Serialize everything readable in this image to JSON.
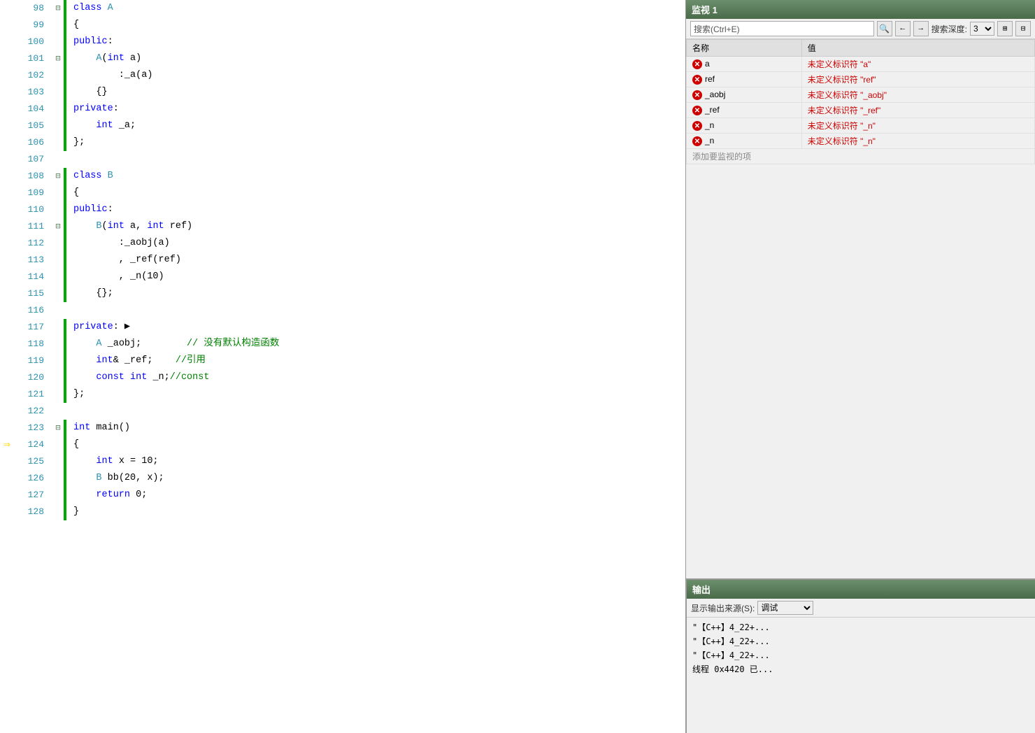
{
  "editor": {
    "lines": [
      {
        "num": 98,
        "hasGreenBar": true,
        "hasFold": true,
        "foldChar": "⊟",
        "content": [
          {
            "type": "kw",
            "text": "class "
          },
          {
            "type": "cls",
            "text": "A"
          }
        ],
        "arrow": false
      },
      {
        "num": 99,
        "hasGreenBar": true,
        "hasFold": false,
        "foldChar": "",
        "content": [
          {
            "type": "plain",
            "text": "{"
          }
        ],
        "arrow": false
      },
      {
        "num": 100,
        "hasGreenBar": true,
        "hasFold": false,
        "foldChar": "",
        "content": [
          {
            "type": "kw",
            "text": "public"
          },
          {
            "type": "plain",
            "text": ":"
          }
        ],
        "arrow": false
      },
      {
        "num": 101,
        "hasGreenBar": true,
        "hasFold": true,
        "foldChar": "⊟",
        "content": [
          {
            "type": "plain",
            "text": "    "
          },
          {
            "type": "cls",
            "text": "A"
          },
          {
            "type": "plain",
            "text": "("
          },
          {
            "type": "kw",
            "text": "int"
          },
          {
            "type": "plain",
            "text": " a)"
          }
        ],
        "arrow": false
      },
      {
        "num": 102,
        "hasGreenBar": true,
        "hasFold": false,
        "foldChar": "",
        "content": [
          {
            "type": "plain",
            "text": "        :_a(a)"
          }
        ],
        "arrow": false
      },
      {
        "num": 103,
        "hasGreenBar": true,
        "hasFold": false,
        "foldChar": "",
        "content": [
          {
            "type": "plain",
            "text": "    {}"
          }
        ],
        "arrow": false
      },
      {
        "num": 104,
        "hasGreenBar": true,
        "hasFold": false,
        "foldChar": "",
        "content": [
          {
            "type": "kw",
            "text": "private"
          },
          {
            "type": "plain",
            "text": ":"
          }
        ],
        "arrow": false
      },
      {
        "num": 105,
        "hasGreenBar": true,
        "hasFold": false,
        "foldChar": "",
        "content": [
          {
            "type": "plain",
            "text": "    "
          },
          {
            "type": "kw",
            "text": "int"
          },
          {
            "type": "plain",
            "text": " _a;"
          }
        ],
        "arrow": false
      },
      {
        "num": 106,
        "hasGreenBar": true,
        "hasFold": false,
        "foldChar": "",
        "content": [
          {
            "type": "plain",
            "text": "};"
          }
        ],
        "arrow": false
      },
      {
        "num": 107,
        "hasGreenBar": false,
        "hasFold": false,
        "foldChar": "",
        "content": [],
        "arrow": false
      },
      {
        "num": 108,
        "hasGreenBar": true,
        "hasFold": true,
        "foldChar": "⊟",
        "content": [
          {
            "type": "kw",
            "text": "class "
          },
          {
            "type": "cls",
            "text": "B"
          }
        ],
        "arrow": false
      },
      {
        "num": 109,
        "hasGreenBar": true,
        "hasFold": false,
        "foldChar": "",
        "content": [
          {
            "type": "plain",
            "text": "{"
          }
        ],
        "arrow": false
      },
      {
        "num": 110,
        "hasGreenBar": true,
        "hasFold": false,
        "foldChar": "",
        "content": [
          {
            "type": "kw",
            "text": "public"
          },
          {
            "type": "plain",
            "text": ":"
          }
        ],
        "arrow": false
      },
      {
        "num": 111,
        "hasGreenBar": true,
        "hasFold": true,
        "foldChar": "⊟",
        "content": [
          {
            "type": "plain",
            "text": "    "
          },
          {
            "type": "cls",
            "text": "B"
          },
          {
            "type": "plain",
            "text": "("
          },
          {
            "type": "kw",
            "text": "int"
          },
          {
            "type": "plain",
            "text": " a, "
          },
          {
            "type": "kw",
            "text": "int"
          },
          {
            "type": "plain",
            "text": " ref)"
          }
        ],
        "arrow": false
      },
      {
        "num": 112,
        "hasGreenBar": true,
        "hasFold": false,
        "foldChar": "",
        "content": [
          {
            "type": "plain",
            "text": "        :_aobj(a)"
          }
        ],
        "arrow": false
      },
      {
        "num": 113,
        "hasGreenBar": true,
        "hasFold": false,
        "foldChar": "",
        "content": [
          {
            "type": "plain",
            "text": "        , _ref(ref)"
          }
        ],
        "arrow": false
      },
      {
        "num": 114,
        "hasGreenBar": true,
        "hasFold": false,
        "foldChar": "",
        "content": [
          {
            "type": "plain",
            "text": "        , _n(10)"
          }
        ],
        "arrow": false
      },
      {
        "num": 115,
        "hasGreenBar": true,
        "hasFold": false,
        "foldChar": "",
        "content": [
          {
            "type": "plain",
            "text": "    {};"
          }
        ],
        "arrow": false
      },
      {
        "num": 116,
        "hasGreenBar": false,
        "hasFold": false,
        "foldChar": "",
        "content": [],
        "arrow": false
      },
      {
        "num": 117,
        "hasGreenBar": true,
        "hasFold": false,
        "foldChar": "",
        "content": [
          {
            "type": "kw",
            "text": "private"
          },
          {
            "type": "plain",
            "text": ":"
          },
          {
            "type": "plain",
            "text": " ▶"
          }
        ],
        "arrow": false
      },
      {
        "num": 118,
        "hasGreenBar": true,
        "hasFold": false,
        "foldChar": "",
        "content": [
          {
            "type": "plain",
            "text": "    "
          },
          {
            "type": "cls",
            "text": "A"
          },
          {
            "type": "plain",
            "text": " _aobj;"
          },
          {
            "type": "cmt",
            "text": "        // 没有默认构造函数"
          }
        ],
        "arrow": false
      },
      {
        "num": 119,
        "hasGreenBar": true,
        "hasFold": false,
        "foldChar": "",
        "content": [
          {
            "type": "plain",
            "text": "    "
          },
          {
            "type": "kw",
            "text": "int"
          },
          {
            "type": "plain",
            "text": "& _ref;"
          },
          {
            "type": "cmt",
            "text": "    //引用"
          }
        ],
        "arrow": false
      },
      {
        "num": 120,
        "hasGreenBar": true,
        "hasFold": false,
        "foldChar": "",
        "content": [
          {
            "type": "plain",
            "text": "    "
          },
          {
            "type": "kw",
            "text": "const"
          },
          {
            "type": "plain",
            "text": " "
          },
          {
            "type": "kw",
            "text": "int"
          },
          {
            "type": "plain",
            "text": " _n;"
          },
          {
            "type": "cmt",
            "text": "//const"
          }
        ],
        "arrow": false
      },
      {
        "num": 121,
        "hasGreenBar": true,
        "hasFold": false,
        "foldChar": "",
        "content": [
          {
            "type": "plain",
            "text": "};"
          }
        ],
        "arrow": false
      },
      {
        "num": 122,
        "hasGreenBar": false,
        "hasFold": false,
        "foldChar": "",
        "content": [],
        "arrow": false
      },
      {
        "num": 123,
        "hasGreenBar": true,
        "hasFold": true,
        "foldChar": "⊟",
        "content": [
          {
            "type": "kw",
            "text": "int"
          },
          {
            "type": "plain",
            "text": " "
          },
          {
            "type": "fn",
            "text": "main"
          },
          {
            "type": "plain",
            "text": "()"
          }
        ],
        "arrow": false
      },
      {
        "num": 124,
        "hasGreenBar": true,
        "hasFold": false,
        "foldChar": "",
        "content": [
          {
            "type": "plain",
            "text": "{"
          }
        ],
        "arrow": true
      },
      {
        "num": 125,
        "hasGreenBar": true,
        "hasFold": false,
        "foldChar": "",
        "content": [
          {
            "type": "plain",
            "text": "    "
          },
          {
            "type": "kw",
            "text": "int"
          },
          {
            "type": "plain",
            "text": " x = 10;"
          }
        ],
        "arrow": false
      },
      {
        "num": 126,
        "hasGreenBar": true,
        "hasFold": false,
        "foldChar": "",
        "content": [
          {
            "type": "plain",
            "text": "    "
          },
          {
            "type": "cls",
            "text": "B"
          },
          {
            "type": "plain",
            "text": " bb(20, x);"
          }
        ],
        "arrow": false
      },
      {
        "num": 127,
        "hasGreenBar": true,
        "hasFold": false,
        "foldChar": "",
        "content": [
          {
            "type": "plain",
            "text": "    "
          },
          {
            "type": "kw",
            "text": "return"
          },
          {
            "type": "plain",
            "text": " 0;"
          }
        ],
        "arrow": false
      },
      {
        "num": 128,
        "hasGreenBar": true,
        "hasFold": false,
        "foldChar": "",
        "content": [
          {
            "type": "plain",
            "text": "}"
          }
        ],
        "arrow": false
      }
    ]
  },
  "watchWindow": {
    "title": "监视 1",
    "searchPlaceholder": "搜索(Ctrl+E)",
    "depthLabel": "搜索深度:",
    "depthValue": "3",
    "columns": [
      "名称",
      "值"
    ],
    "rows": [
      {
        "name": "a",
        "value": "未定义标识符 \"a\"",
        "isError": true,
        "valueRed": false
      },
      {
        "name": "ref",
        "value": "未定义标识符 \"ref\"",
        "isError": true,
        "valueRed": false
      },
      {
        "name": "_aobj",
        "value": "未定义标识符 \"_aobj\"",
        "isError": true,
        "valueRed": false
      },
      {
        "name": "_ref",
        "value": "未定义标识符 \"_ref\"",
        "isError": true,
        "valueRed": false
      },
      {
        "name": "_n",
        "value": "未定义标识符 \"_n\"",
        "isError": true,
        "valueRed": true
      },
      {
        "name": "_n",
        "value": "未定义标识符 \"_n\"",
        "isError": true,
        "valueRed": true
      }
    ],
    "addRowLabel": "添加要监视的项"
  },
  "outputPanel": {
    "title": "输出",
    "sourceLabel": "显示输出来源(S):",
    "lines": [
      "\"【C++】4_22+...",
      "\"【C++】4_22+...",
      "\"【C++】4_22+...",
      "线程 0x4420 已..."
    ]
  }
}
